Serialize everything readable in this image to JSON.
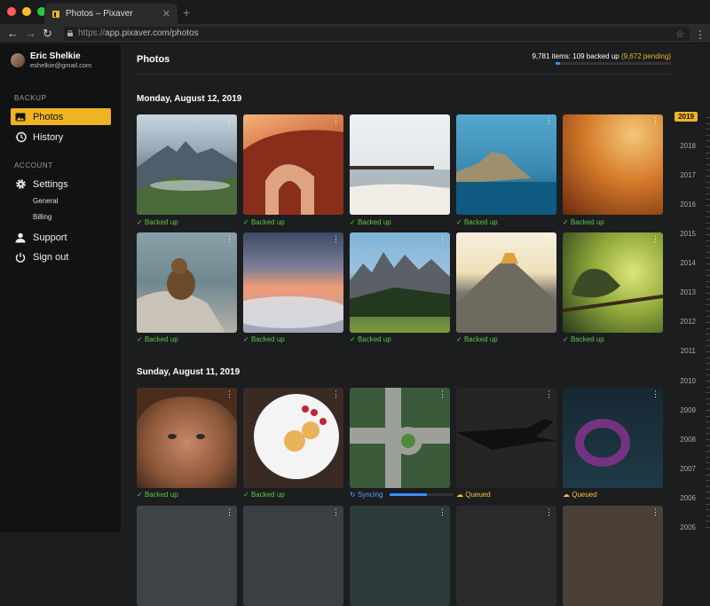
{
  "browser": {
    "tab_title": "Photos – Pixaver",
    "url_protocol": "https://",
    "url_rest": "app.pixaver.com/photos"
  },
  "user": {
    "name": "Eric Shelkie",
    "email": "eshelkie@gmail.com"
  },
  "sidebar": {
    "backup_heading": "BACKUP",
    "photos": "Photos",
    "history": "History",
    "account_heading": "ACCOUNT",
    "settings": "Settings",
    "general": "General",
    "billing": "Billing",
    "support": "Support",
    "signout": "Sign out"
  },
  "main": {
    "title": "Photos",
    "status_count": "9,781 items: 109 backed up ",
    "status_pending": "(9,672 pending)",
    "progress": 0.04,
    "groups": [
      {
        "date": "Monday, August 12, 2019"
      },
      {
        "date": "Sunday, August 11, 2019"
      }
    ],
    "status_labels": {
      "ok": "Backed up",
      "sync": "Syncing",
      "queue": "Queued"
    }
  },
  "photos": [
    {
      "status": "ok"
    },
    {
      "status": "ok"
    },
    {
      "status": "ok"
    },
    {
      "status": "ok"
    },
    {
      "status": "ok"
    },
    {
      "status": "ok"
    },
    {
      "status": "ok"
    },
    {
      "status": "ok"
    },
    {
      "status": "ok"
    },
    {
      "status": "ok"
    },
    {
      "status": "ok"
    },
    {
      "status": "ok"
    },
    {
      "status": "sync"
    },
    {
      "status": "queue"
    },
    {
      "status": "queue"
    }
  ],
  "timeline": {
    "current": "2019",
    "years": [
      "2018",
      "2017",
      "2016",
      "2015",
      "2014",
      "2013",
      "2012",
      "2011",
      "2010",
      "2009",
      "2008",
      "2007",
      "2006",
      "2005"
    ]
  },
  "colors": {
    "accent": "#f0b323",
    "ok": "#5ec34c",
    "sync": "#5aa1ff",
    "queue": "#f0c040"
  }
}
